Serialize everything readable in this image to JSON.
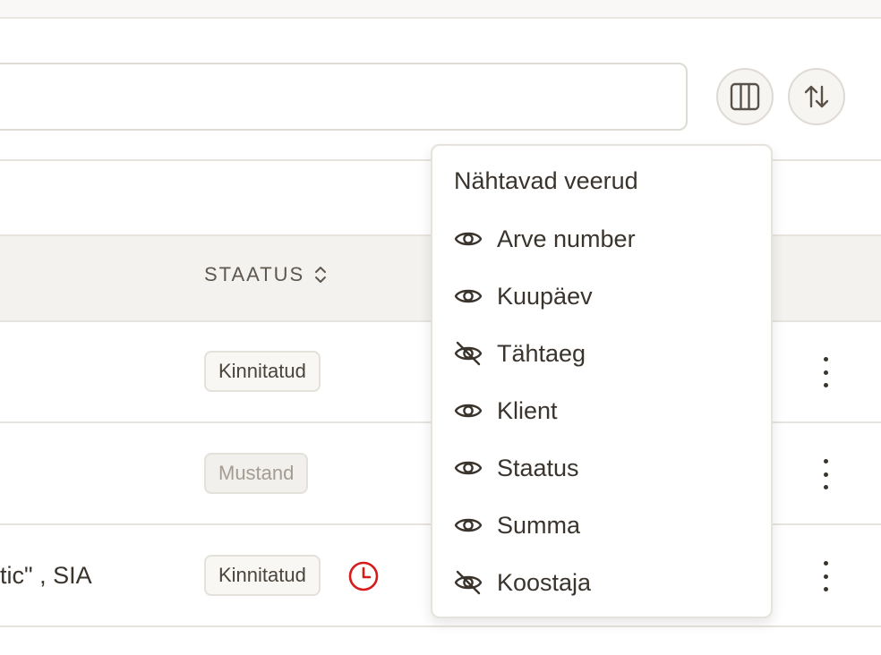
{
  "table": {
    "status_header": "STAATUS",
    "rows": [
      {
        "client": "",
        "status": "Kinnitatud",
        "status_type": "confirmed",
        "overdue": false
      },
      {
        "client": "",
        "status": "Mustand",
        "status_type": "draft",
        "overdue": false
      },
      {
        "client": "tic\" , SIA",
        "status": "Kinnitatud",
        "status_type": "confirmed",
        "overdue": true
      }
    ]
  },
  "toolbar": {
    "columns_icon": "columns-icon",
    "sort_icon": "sort-arrows-icon"
  },
  "column_menu": {
    "title": "Nähtavad veerud",
    "items": [
      {
        "label": "Arve number",
        "visible": true
      },
      {
        "label": "Kuupäev",
        "visible": true
      },
      {
        "label": "Tähtaeg",
        "visible": false
      },
      {
        "label": "Klient",
        "visible": true
      },
      {
        "label": "Staatus",
        "visible": true
      },
      {
        "label": "Summa",
        "visible": true
      },
      {
        "label": "Koostaja",
        "visible": false
      }
    ]
  },
  "colors": {
    "overdue": "#d71b1b",
    "border": "#e7e3de",
    "text": "#3a342d"
  }
}
